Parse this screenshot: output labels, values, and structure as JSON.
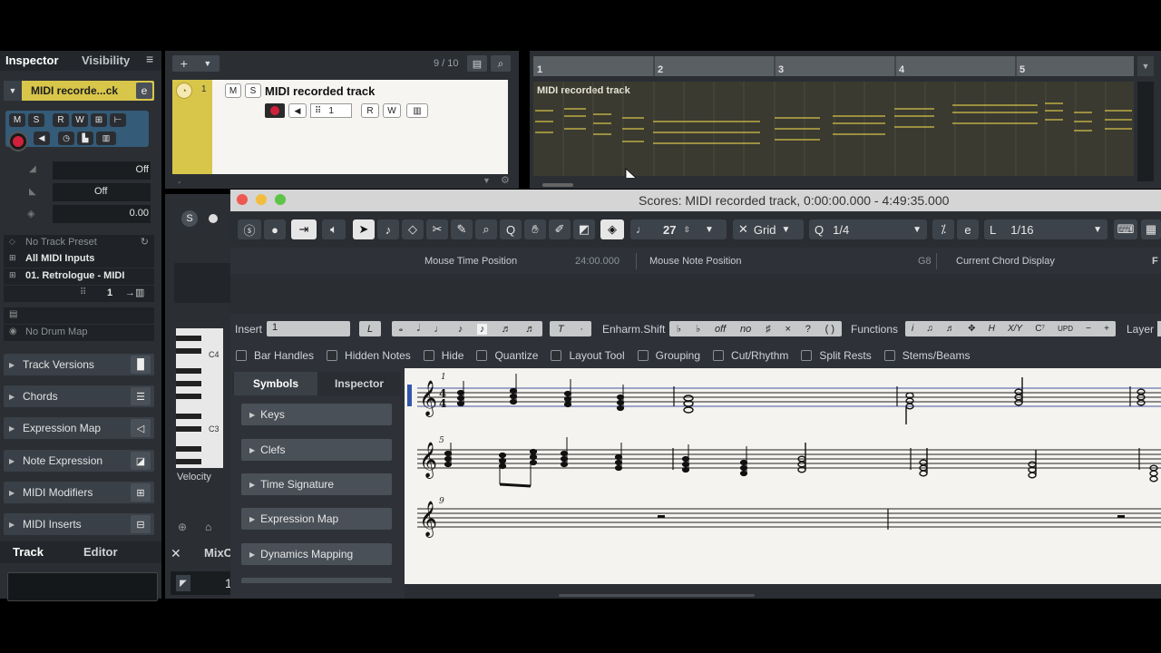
{
  "inspector": {
    "tab_inspector": "Inspector",
    "tab_visibility": "Visibility",
    "track_name": "MIDI recorde...ck",
    "fader_off": "Off",
    "pan_off": "Off",
    "delay_value": "0.00",
    "no_track_preset": "No Track Preset",
    "all_midi_inputs": "All MIDI Inputs",
    "output": "01. Retrologue - MIDI",
    "channel": "1",
    "no_drum_map": "No Drum Map",
    "sections": [
      "Track Versions",
      "Chords",
      "Expression Map",
      "Note Expression",
      "MIDI Modifiers",
      "MIDI Inserts"
    ],
    "bottom_tab_track": "Track",
    "bottom_tab_editor": "Editor"
  },
  "tracklist": {
    "count": "9 / 10",
    "track_number": "1",
    "track_name": "MIDI recorded track",
    "m": "M",
    "s": "S",
    "r": "R",
    "w": "W",
    "channel": "1"
  },
  "arrange": {
    "ruler": [
      "1",
      "2",
      "3",
      "4",
      "5"
    ],
    "part_name": "MIDI recorded track"
  },
  "lower_editor": {
    "key_c4": "C4",
    "key_c3": "C3",
    "velocity": "Velocity",
    "mix_tab": "MixC",
    "transport_value": "1"
  },
  "score": {
    "title": "Scores: MIDI recorded track, 0:00:00.000 - 4:49:35.000",
    "tempo_value": "27",
    "grid_label": "Grid",
    "quantize_value": "1/4",
    "length_value": "1/16",
    "length_prefix": "L",
    "info": {
      "mouse_time_label": "Mouse Time Position",
      "mouse_time_value": "24:00.000",
      "mouse_note_label": "Mouse Note Position",
      "mouse_note_value": "G8",
      "chord_label": "Current Chord Display",
      "chord_value": "F"
    },
    "insert_label": "Insert",
    "insert_value": "1",
    "enharm_label": "Enharm.Shift",
    "enharm_off": "off",
    "enharm_no": "no",
    "functions_label": "Functions",
    "layer_label": "Layer",
    "options": [
      "Bar Handles",
      "Hidden Notes",
      "Hide",
      "Quantize",
      "Layout Tool",
      "Grouping",
      "Cut/Rhythm",
      "Split Rests",
      "Stems/Beams"
    ],
    "panel_tab_symbols": "Symbols",
    "panel_tab_inspector": "Inspector",
    "symbol_sections": [
      "Keys",
      "Clefs",
      "Time Signature",
      "Expression Map",
      "Dynamics Mapping"
    ],
    "bar_numbers": [
      "1",
      "5",
      "9"
    ]
  },
  "colors": {
    "track_yellow": "#d8c64a",
    "record_red": "#d0203c",
    "selection_blue": "#3355aa",
    "midi_line": "#d8c24a"
  }
}
